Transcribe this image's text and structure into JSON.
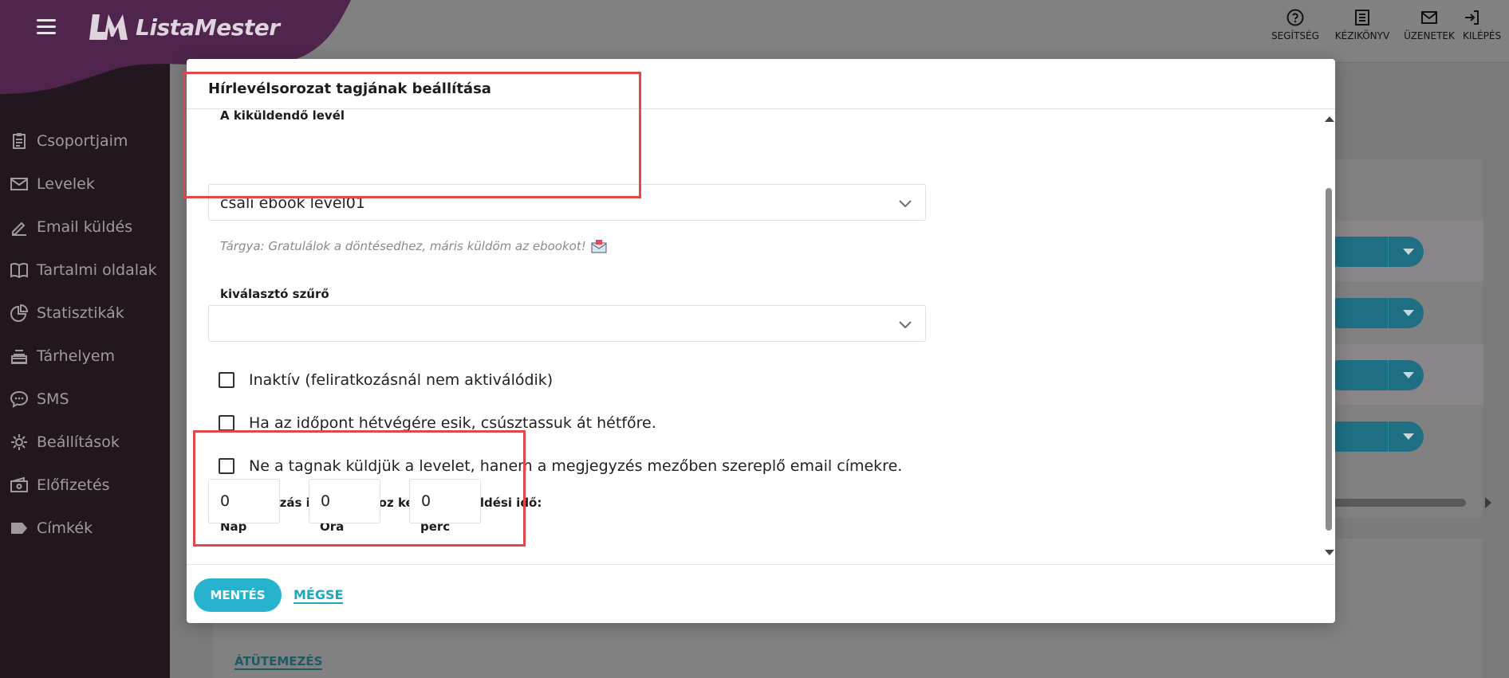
{
  "app": {
    "brand": "ListaMester",
    "brand_color": "#5b2a58"
  },
  "sidebar": {
    "items": [
      {
        "label": "Csoportjaim",
        "icon": "clipboard-icon"
      },
      {
        "label": "Levelek",
        "icon": "mail-icon"
      },
      {
        "label": "Email küldés",
        "icon": "pencil-icon"
      },
      {
        "label": "Tartalmi oldalak",
        "icon": "book-icon"
      },
      {
        "label": "Statisztikák",
        "icon": "pie-chart-icon"
      },
      {
        "label": "Tárhelyem",
        "icon": "storage-icon"
      },
      {
        "label": "SMS",
        "icon": "chat-icon"
      },
      {
        "label": "Beállítások",
        "icon": "gear-icon"
      },
      {
        "label": "Előfizetés",
        "icon": "wallet-icon"
      },
      {
        "label": "Címkék",
        "icon": "tag-icon"
      }
    ]
  },
  "topbar": {
    "actions": [
      {
        "label": "SEGÍTSÉG",
        "icon": "help-icon"
      },
      {
        "label": "KÉZIKÖNYV",
        "icon": "manual-icon"
      },
      {
        "label": "ÜZENETEK",
        "icon": "messages-icon"
      },
      {
        "label": "KILÉPÉS",
        "icon": "logout-icon"
      }
    ]
  },
  "background": {
    "link": "ÁTÜTEMEZÉS"
  },
  "modal": {
    "title": "Hírlevélsorozat tagjának beállítása",
    "letter_field": {
      "label": "A kiküldendő levél",
      "value": "csali ebook levél01"
    },
    "subject": "Tárgya: Gratulálok a döntésedhez, máris küldöm az ebookot!",
    "filter_field": {
      "label": "kiválasztó szűrő",
      "value": ""
    },
    "checkboxes": [
      {
        "label": "Inaktív (feliratkozásnál nem aktiválódik)",
        "checked": false
      },
      {
        "label": "Ha az időpont hétvégére esik, csúsztassuk át hétfőre.",
        "checked": false
      },
      {
        "label": "Ne a tagnak küldjük a levelet, hanem a megjegyzés mezőben szereplő email címekre.",
        "checked": false
      }
    ],
    "timing": {
      "label": "Feliratkozás időpontjához képesti kiküldési idő:",
      "day_label": "Nap",
      "day_value": "0",
      "hour_label": "Óra",
      "hour_value": "0",
      "minute_label": "perc",
      "minute_value": "0"
    },
    "save_label": "MENTÉS",
    "cancel_label": "MÉGSE",
    "accent_color": "#27b3cd",
    "highlight_color": "#e2474e"
  }
}
